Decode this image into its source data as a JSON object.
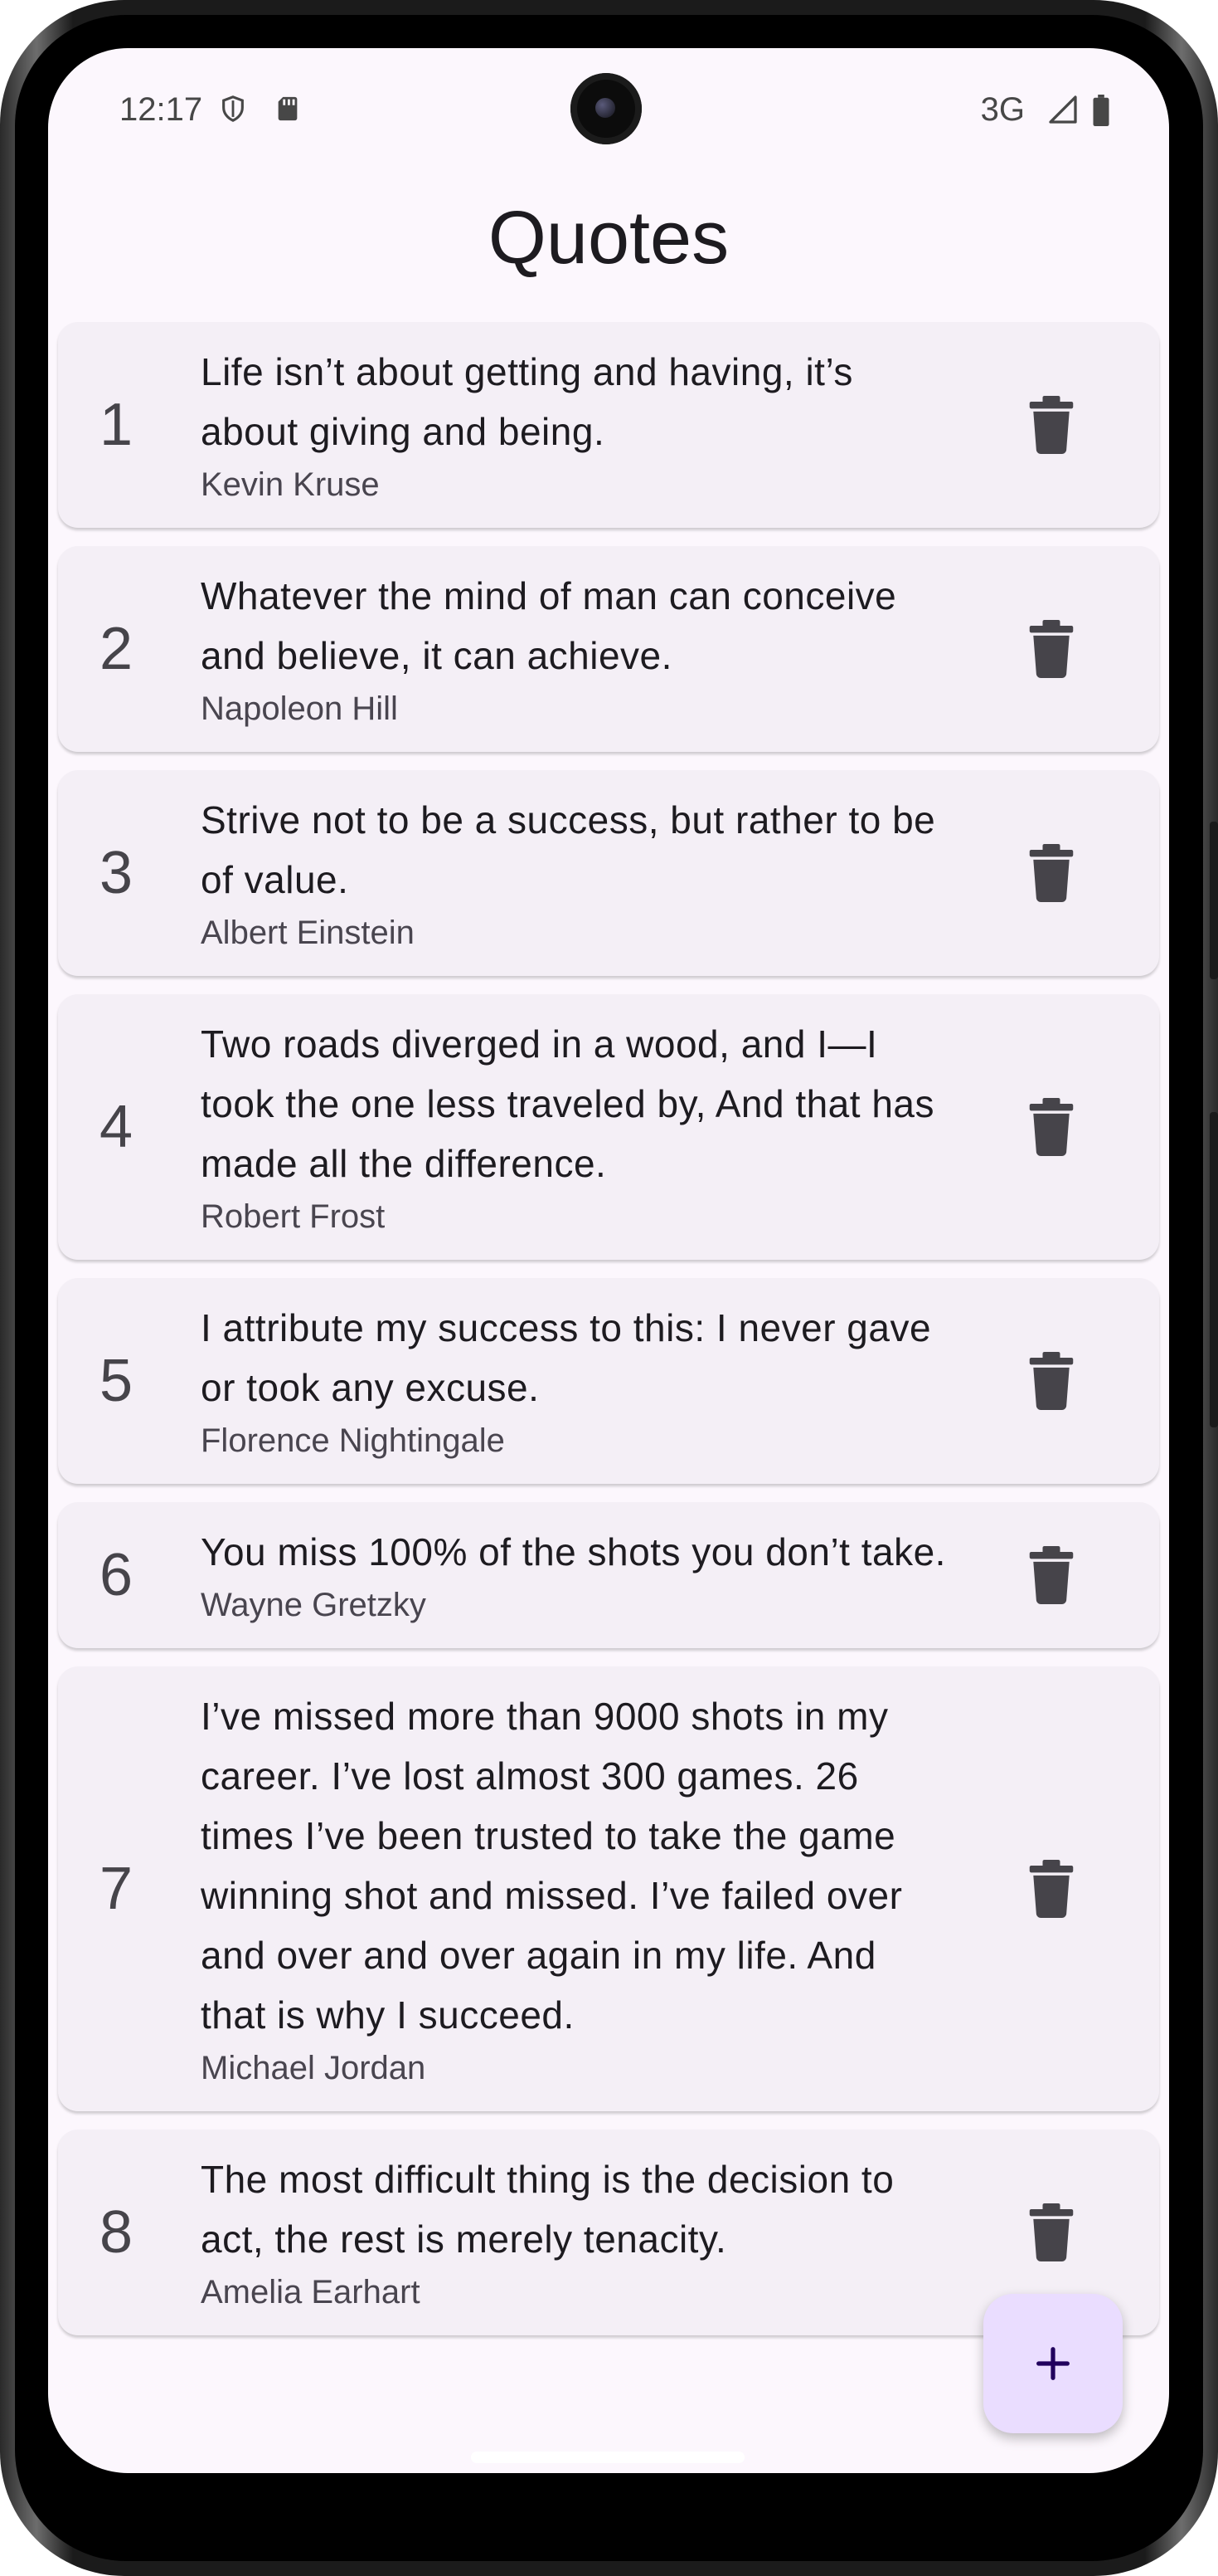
{
  "status_bar": {
    "time": "12:17",
    "network": "3G",
    "left_icons": [
      "shield-icon",
      "sim-card-icon"
    ],
    "right_icons": [
      "signal-icon",
      "battery-icon"
    ]
  },
  "app": {
    "title": "Quotes"
  },
  "quotes": [
    {
      "number": "1",
      "text": "Life isn’t about getting and having, it’s about giving and being.",
      "author": "Kevin Kruse"
    },
    {
      "number": "2",
      "text": "Whatever the mind of man can conceive and believe, it can achieve.",
      "author": "Napoleon Hill"
    },
    {
      "number": "3",
      "text": "Strive not to be a success, but rather to be of value.",
      "author": "Albert Einstein"
    },
    {
      "number": "4",
      "text": "Two roads diverged in a wood, and I—I took the one less traveled by, And that has made all the difference.",
      "author": "Robert Frost"
    },
    {
      "number": "5",
      "text": "I attribute my success to this: I never gave or took any excuse.",
      "author": "Florence Nightingale"
    },
    {
      "number": "6",
      "text": "You miss 100% of the shots you don’t take.",
      "author": "Wayne Gretzky"
    },
    {
      "number": "7",
      "text": "I’ve missed more than 9000 shots in my career. I’ve lost almost 300 games. 26 times I’ve been trusted to take the game winning shot and missed. I’ve failed over and over and over again in my life. And that is why I succeed.",
      "author": "Michael Jordan"
    },
    {
      "number": "8",
      "text": "The most difficult thing is the decision to act, the rest is merely tenacity.",
      "author": "Amelia Earhart"
    }
  ],
  "fab": {
    "icon": "plus-icon"
  },
  "colors": {
    "background": "#fcf7fd",
    "card": "#f4eff6",
    "fab": "#eaddff",
    "icon": "#46444a",
    "fab_icon": "#21005d"
  }
}
